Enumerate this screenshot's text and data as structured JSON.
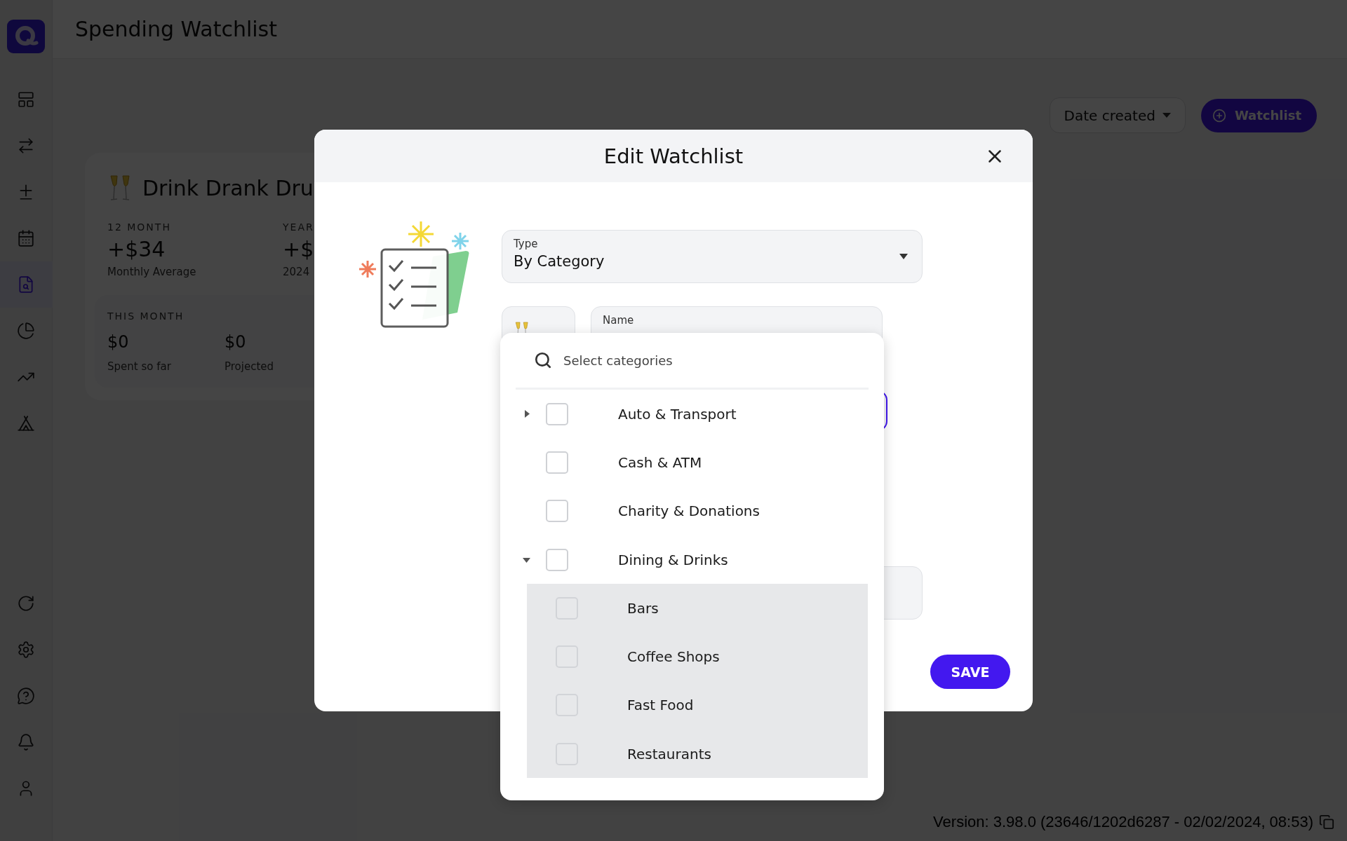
{
  "sidebar": {
    "items": [
      {
        "selected": false
      },
      {
        "selected": false
      },
      {
        "selected": false
      },
      {
        "selected": false
      },
      {
        "selected": true
      },
      {
        "selected": false
      },
      {
        "selected": false
      },
      {
        "selected": false
      }
    ],
    "bottom_items": [
      {
        "selected": false
      },
      {
        "selected": false
      },
      {
        "selected": false
      },
      {
        "selected": false
      },
      {
        "selected": false
      }
    ]
  },
  "page": {
    "title": "Spending Watchlist"
  },
  "toolbar": {
    "sort": {
      "label": "Date created"
    },
    "add_button": {
      "label": "Watchlist"
    }
  },
  "watchlist_card": {
    "title": "Drink Drank Dru",
    "stats": [
      {
        "heading": "12 MONTH",
        "value": "+$34",
        "caption": "Monthly Average"
      },
      {
        "heading": "YEAR",
        "value": "+$",
        "caption": "2024"
      }
    ],
    "this_month": {
      "heading": "THIS MONTH",
      "stats": [
        {
          "value": "$0",
          "caption": "Spent so far"
        },
        {
          "value": "$0",
          "caption": "Projected"
        }
      ]
    }
  },
  "modal": {
    "title": "Edit Watchlist",
    "type_field": {
      "label": "Type",
      "value": "By Category"
    },
    "name_field": {
      "label": "Name"
    },
    "save_button": "SAVE"
  },
  "category_dropdown": {
    "placeholder": "Select categories",
    "items": [
      {
        "label": "Auto & Transport",
        "checked": false,
        "expanded": false
      },
      {
        "label": "Cash & ATM",
        "checked": false
      },
      {
        "label": "Charity & Donations",
        "checked": false
      },
      {
        "label": "Dining & Drinks",
        "checked": false,
        "expanded": true,
        "children": [
          {
            "label": "Bars",
            "checked": false
          },
          {
            "label": "Coffee Shops",
            "checked": false
          },
          {
            "label": "Fast Food",
            "checked": false
          },
          {
            "label": "Restaurants",
            "checked": false
          }
        ]
      }
    ]
  },
  "footer": {
    "version": "Version: 3.98.0 (23646/1202d6287 - 02/02/2024, 08:53)"
  }
}
